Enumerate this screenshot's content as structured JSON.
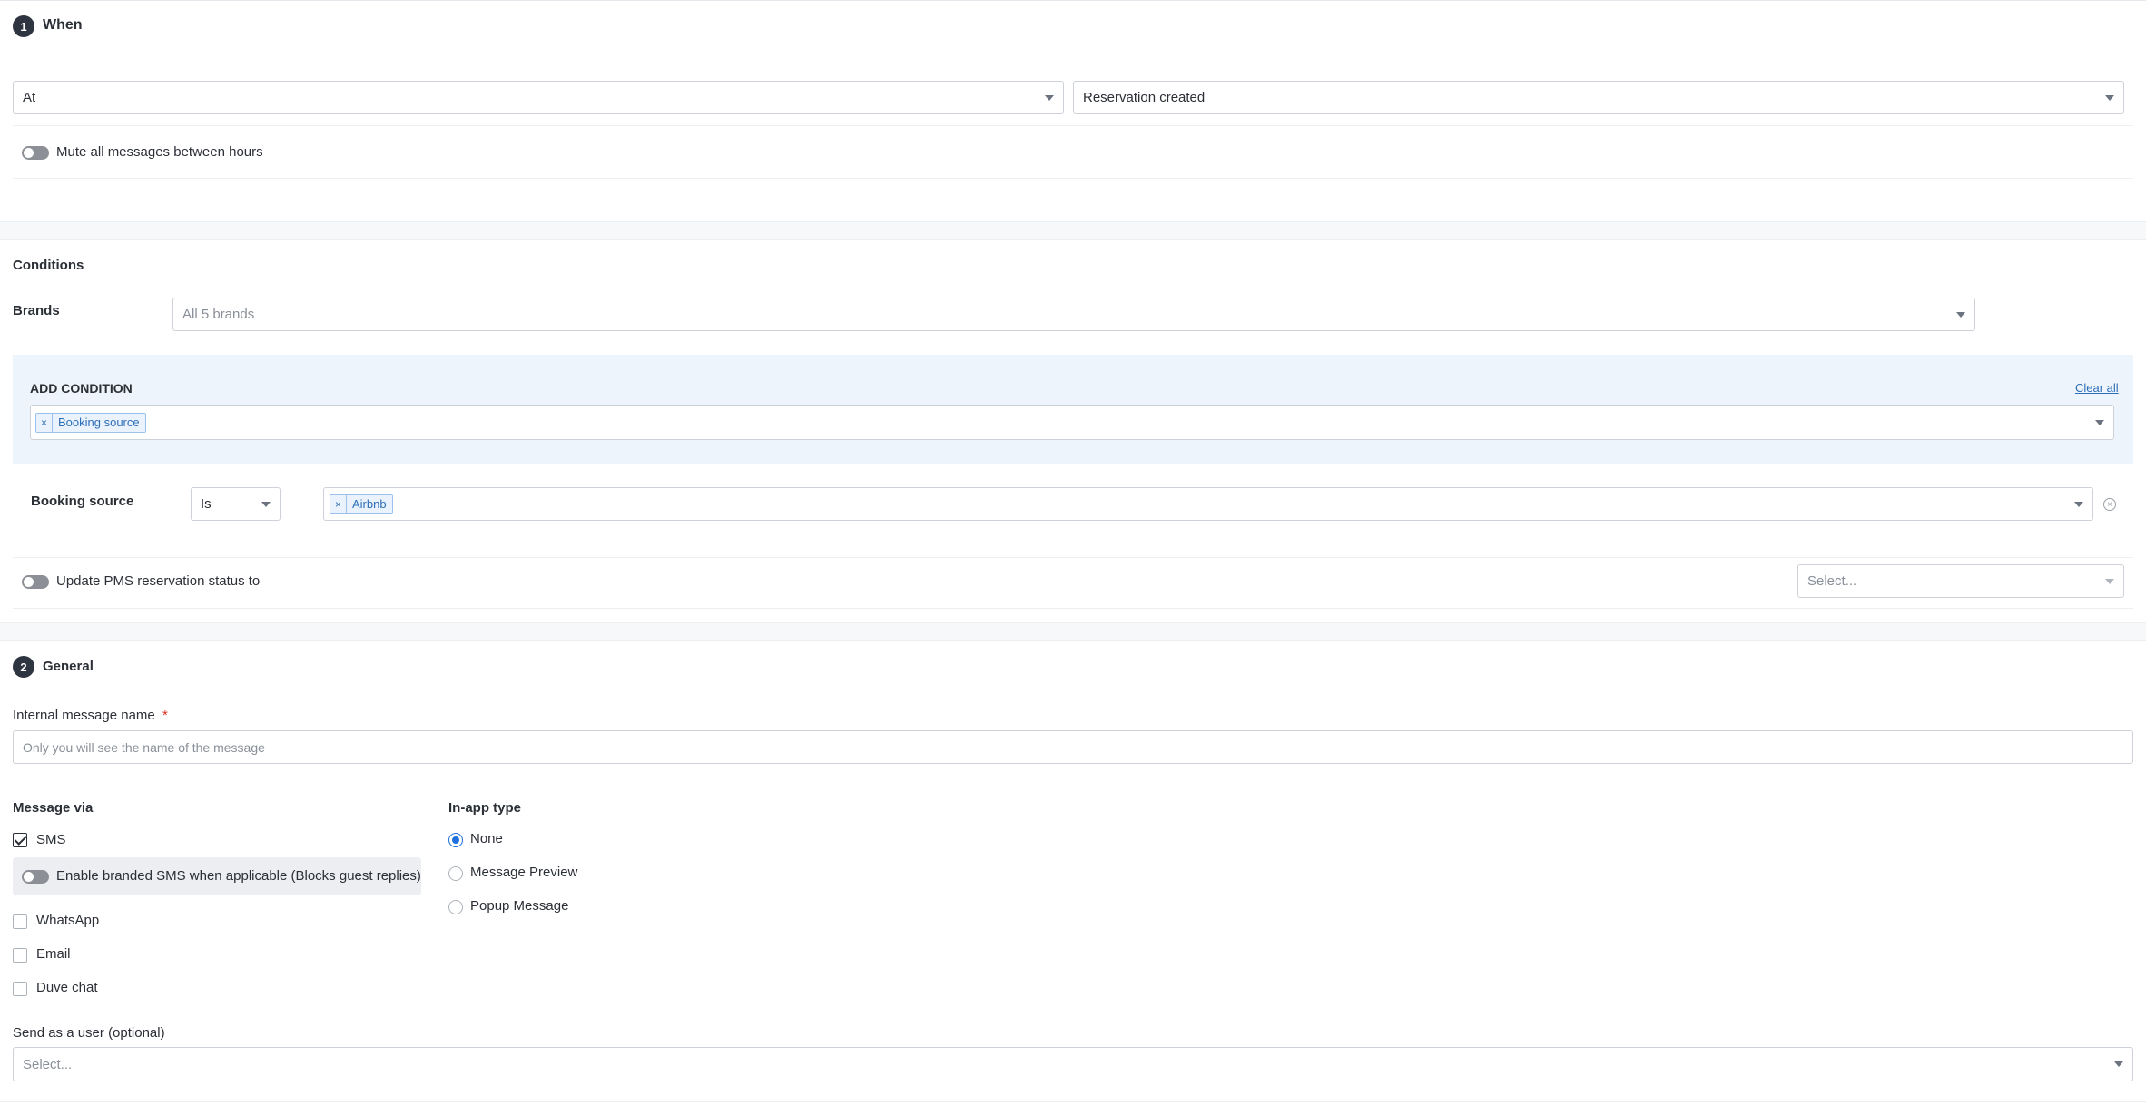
{
  "when": {
    "step": "1",
    "title": "When",
    "timing_select": "At",
    "event_select": "Reservation created",
    "mute_label": "Mute all messages between hours"
  },
  "conditions": {
    "title": "Conditions",
    "brands_label": "Brands",
    "brands_placeholder": "All 5 brands",
    "add_condition_title": "ADD CONDITION",
    "clear_all": "Clear all",
    "condition_tags": [
      "Booking source"
    ],
    "booking_source": {
      "label": "Booking source",
      "operator": "Is",
      "values": [
        "Airbnb"
      ]
    },
    "update_pms_label": "Update PMS reservation status to",
    "update_pms_placeholder": "Select..."
  },
  "general": {
    "step": "2",
    "title": "General",
    "internal_name_label": "Internal message name",
    "required_mark": "*",
    "internal_name_placeholder": "Only you will see the name of the message",
    "message_via_label": "Message via",
    "channels": {
      "sms": "SMS",
      "branded_sms": "Enable branded SMS when applicable (Blocks guest replies)",
      "whatsapp": "WhatsApp",
      "email": "Email",
      "duve_chat": "Duve chat"
    },
    "inapp_label": "In-app type",
    "inapp_options": [
      "None",
      "Message Preview",
      "Popup Message"
    ],
    "send_as_label": "Send as a user (optional)",
    "send_as_placeholder": "Select..."
  },
  "colors": {
    "accent": "#1f6fe0",
    "tag_bg": "#eaf3fd",
    "condition_bg": "#eef4fb",
    "required": "#d93025"
  }
}
